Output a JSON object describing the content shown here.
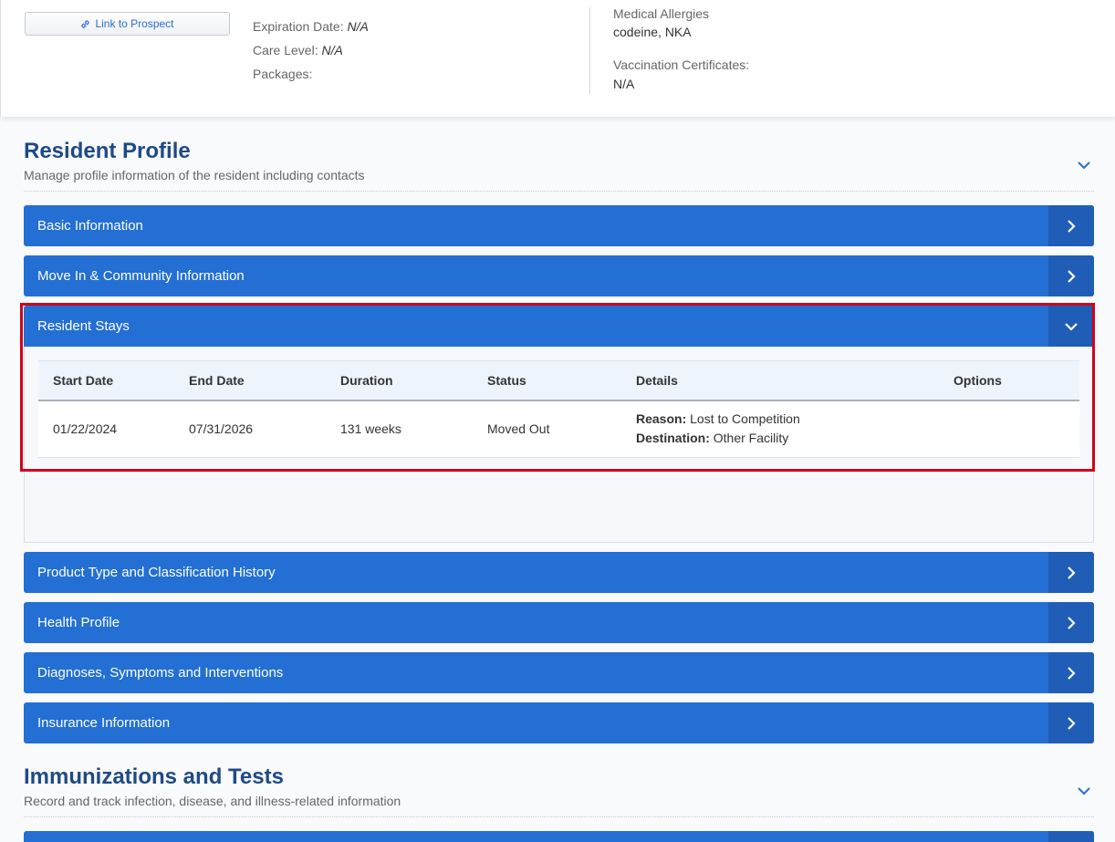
{
  "top": {
    "link_button": "Link to Prospect",
    "expiration_label": "Expiration Date:",
    "expiration_value": "N/A",
    "care_level_label": "Care Level:",
    "care_level_value": "N/A",
    "packages_label": "Packages:",
    "allergies_label": "Medical Allergies",
    "allergies_value": "codeine, NKA",
    "vaccination_label": "Vaccination Certificates:",
    "vaccination_value": "N/A"
  },
  "resident_profile": {
    "title": "Resident Profile",
    "subtitle": "Manage profile information of the resident including contacts"
  },
  "accordions": {
    "basic": "Basic Information",
    "move_in": "Move In & Community Information",
    "stays": "Resident Stays",
    "product": "Product Type and Classification History",
    "health": "Health Profile",
    "diagnoses": "Diagnoses, Symptoms and Interventions",
    "insurance": "Insurance Information"
  },
  "stays_table": {
    "headers": [
      "Start Date",
      "End Date",
      "Duration",
      "Status",
      "Details",
      "Options"
    ],
    "rows": [
      {
        "start": "01/22/2024",
        "end": "07/31/2026",
        "duration": "131 weeks",
        "status": "Moved Out",
        "reason_label": "Reason:",
        "reason_value": "Lost to Competition",
        "destination_label": "Destination:",
        "destination_value": "Other Facility"
      }
    ]
  },
  "immunizations": {
    "title": "Immunizations and Tests",
    "subtitle": "Record and track infection, disease, and illness-related information"
  },
  "icons": {
    "link": "link-icon",
    "chevron_right": "chevron-right-icon",
    "chevron_down": "chevron-down-icon"
  },
  "colors": {
    "accordion_bar": "#236fd3",
    "accordion_button": "#1f5db7",
    "section_title": "#1e4a86",
    "highlight": "#d0021b"
  }
}
